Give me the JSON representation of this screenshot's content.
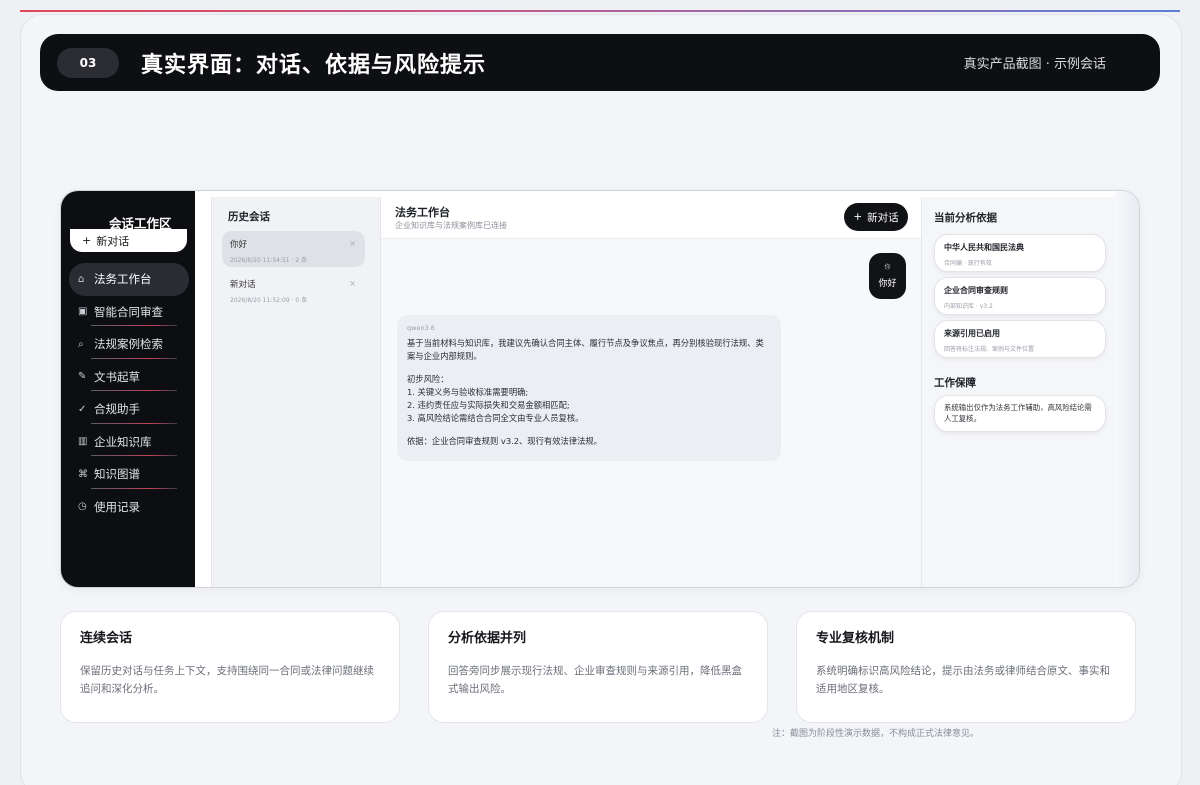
{
  "header": {
    "number": "03",
    "title": "真实界面：对话、依据与风险提示",
    "subtitle": "真实产品截图 · 示例会话"
  },
  "sidebar": {
    "title": "会话工作区",
    "new_chat": "新对话",
    "items": [
      {
        "label": "法务工作台",
        "icon": "home-icon",
        "active": true
      },
      {
        "label": "智能合同审查",
        "icon": "document-icon"
      },
      {
        "label": "法规案例检索",
        "icon": "search-icon"
      },
      {
        "label": "文书起草",
        "icon": "pen-icon"
      },
      {
        "label": "合规助手",
        "icon": "check-icon"
      },
      {
        "label": "企业知识库",
        "icon": "book-icon"
      },
      {
        "label": "知识图谱",
        "icon": "graph-icon"
      },
      {
        "label": "使用记录",
        "icon": "clock-icon"
      }
    ]
  },
  "history": {
    "title": "历史会话",
    "items": [
      {
        "name": "你好",
        "meta": "2026/8/20 11:54:51 · 2 条"
      },
      {
        "name": "新对话",
        "meta": "2026/8/20 11:52:09 · 0 条"
      }
    ]
  },
  "chat": {
    "title": "法务工作台",
    "subtitle": "企业知识库与法规案例库已连接",
    "new_chat_button": "新对话",
    "user_message": {
      "label": "你",
      "text": "你好"
    },
    "ai_message": {
      "model": "qwen3.6",
      "intro": "基于当前材料与知识库，我建议先确认合同主体、履行节点及争议焦点，再分别核验现行法规、类案与企业内部规则。",
      "risk_title": "初步风险：",
      "risks": [
        "1. 关键义务与验收标准需要明确;",
        "2. 违约责任应与实际损失和交易金额相匹配;",
        "3. 高风险结论需结合合同全文由专业人员复核。"
      ],
      "basis": "依据：企业合同审查规则 v3.2、现行有效法律法规。"
    }
  },
  "evidence": {
    "title": "当前分析依据",
    "cards": [
      {
        "name": "中华人民共和国民法典",
        "meta": "合同编 · 现行有效"
      },
      {
        "name": "企业合同审查规则",
        "meta": "内部知识库 · v3.2"
      },
      {
        "name": "来源引用已启用",
        "meta": "回答将标注法规、案例与文件位置"
      }
    ],
    "guarantee_title": "工作保障",
    "guarantee_text": "系统输出仅作为法务工作辅助，高风险结论需人工复核。"
  },
  "features": [
    {
      "title": "连续会话",
      "desc": "保留历史对话与任务上下文，支持围绕同一合同或法律问题继续追问和深化分析。"
    },
    {
      "title": "分析依据并列",
      "desc": "回答旁同步展示现行法规、企业审查规则与来源引用，降低黑盒式输出风险。"
    },
    {
      "title": "专业复核机制",
      "desc": "系统明确标识高风险结论，提示由法务或律师结合原文、事实和适用地区复核。"
    }
  ],
  "footnote": "注：截图为阶段性演示数据，不构成正式法律意见。"
}
